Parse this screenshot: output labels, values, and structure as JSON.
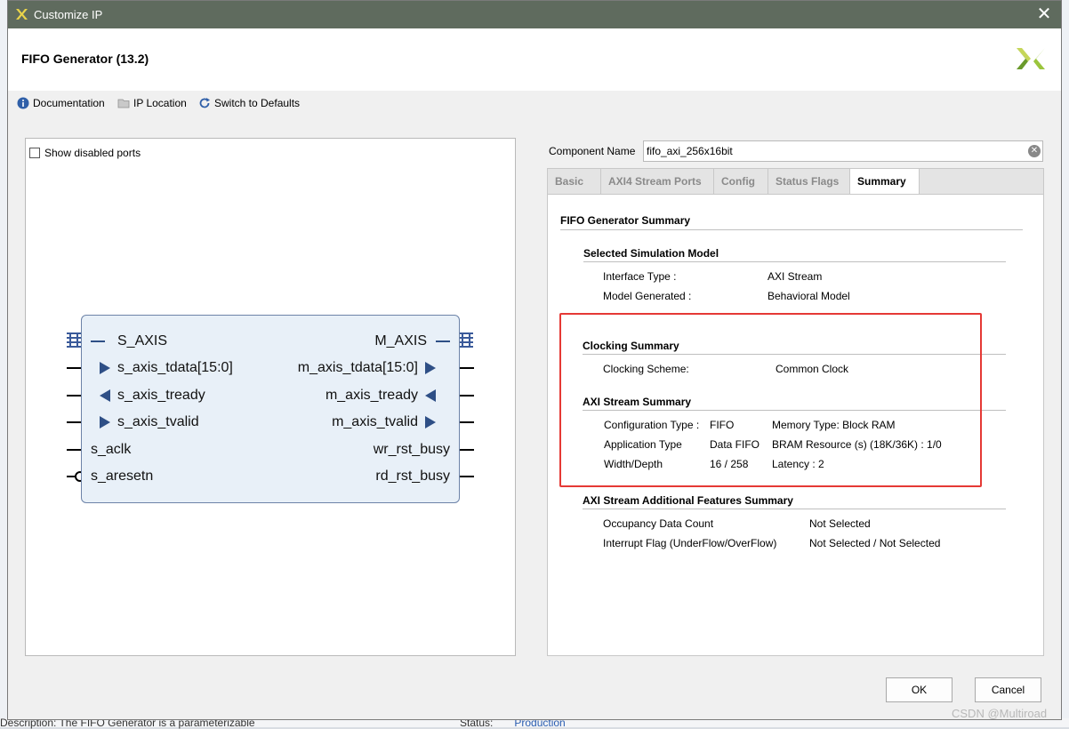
{
  "window": {
    "title": "Customize IP",
    "heading": "FIFO Generator (13.2)",
    "close": "✕"
  },
  "toolbar": {
    "documentation": "Documentation",
    "ip_location": "IP Location",
    "switch_defaults": "Switch to Defaults"
  },
  "left": {
    "show_disabled_ports": "Show disabled ports",
    "block": {
      "left_ports": [
        "S_AXIS",
        "s_axis_tdata[15:0]",
        "s_axis_tready",
        "s_axis_tvalid",
        "s_aclk",
        "s_aresetn"
      ],
      "right_ports": [
        "M_AXIS",
        "m_axis_tdata[15:0]",
        "m_axis_tready",
        "m_axis_tvalid",
        "wr_rst_busy",
        "rd_rst_busy"
      ]
    }
  },
  "right": {
    "component_name_label": "Component Name",
    "component_name_value": "fifo_axi_256x16bit",
    "tabs": [
      "Basic",
      "AXI4 Stream Ports",
      "Config",
      "Status Flags",
      "Summary"
    ],
    "active_tab": "Summary",
    "summary": {
      "title": "FIFO Generator Summary",
      "sim_model": {
        "heading": "Selected Simulation Model",
        "interface_type_label": "Interface Type :",
        "interface_type_value": "AXI Stream",
        "model_generated_label": "Model Generated :",
        "model_generated_value": "Behavioral Model"
      },
      "clocking": {
        "heading": "Clocking Summary",
        "scheme_label": "Clocking Scheme:",
        "scheme_value": "Common Clock"
      },
      "axi_stream": {
        "heading": "AXI Stream Summary",
        "rows": [
          [
            "Configuration Type :",
            "FIFO",
            "Memory Type: Block RAM"
          ],
          [
            "Application Type",
            "Data FIFO",
            "BRAM Resource (s) (18K/36K) : 1/0"
          ],
          [
            "Width/Depth",
            "16 / 258",
            "Latency : 2"
          ]
        ]
      },
      "additional": {
        "heading": "AXI Stream Additional Features Summary",
        "occupancy_label": "Occupancy Data Count",
        "occupancy_value": "Not Selected",
        "interrupt_label": "Interrupt Flag (UnderFlow/OverFlow)",
        "interrupt_value": "Not Selected / Not Selected"
      }
    }
  },
  "buttons": {
    "ok": "OK",
    "cancel": "Cancel"
  },
  "background": {
    "status_label": "Status:",
    "status_value": "Production",
    "description": "Description:    The FIFO Generator is a parameterizable"
  },
  "watermark": "CSDN @Multiroad",
  "colors": {
    "titlebar": "#5f6b5e",
    "highlight": "#e53935",
    "port_arrow": "#2e4f86",
    "block_fill": "#e8f0f8"
  }
}
